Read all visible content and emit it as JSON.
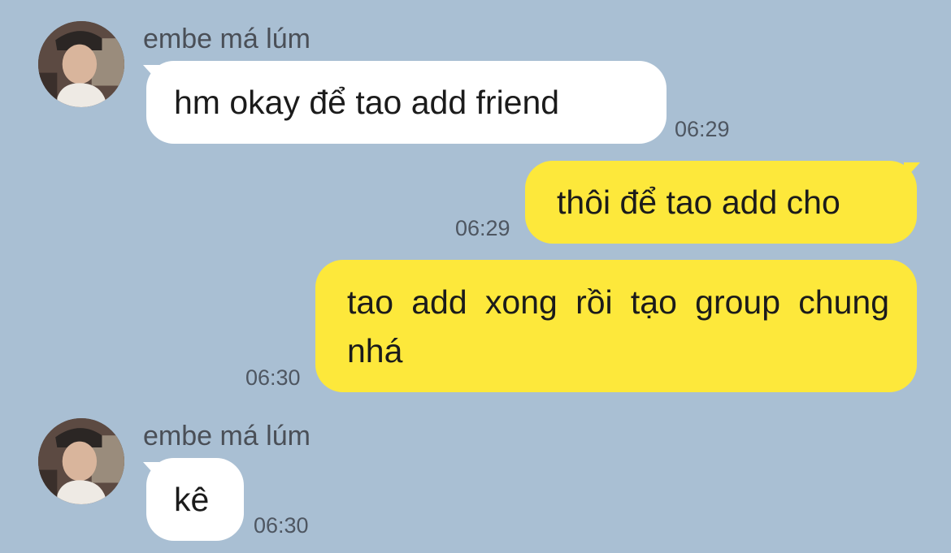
{
  "messages": [
    {
      "direction": "incoming",
      "sender": "embe má lúm",
      "text": "hm okay để tao add friend",
      "time": "06:29"
    },
    {
      "direction": "outgoing",
      "text": "thôi để tao add cho",
      "time": "06:29"
    },
    {
      "direction": "outgoing",
      "text": "tao add xong rồi tạo group chung nhá",
      "time": "06:30"
    },
    {
      "direction": "incoming",
      "sender": "embe má lúm",
      "text": "kê",
      "time": "06:30"
    }
  ],
  "colors": {
    "background": "#a9bfd3",
    "incoming_bubble": "#ffffff",
    "outgoing_bubble": "#fde83b",
    "timestamp": "#4e5661"
  }
}
